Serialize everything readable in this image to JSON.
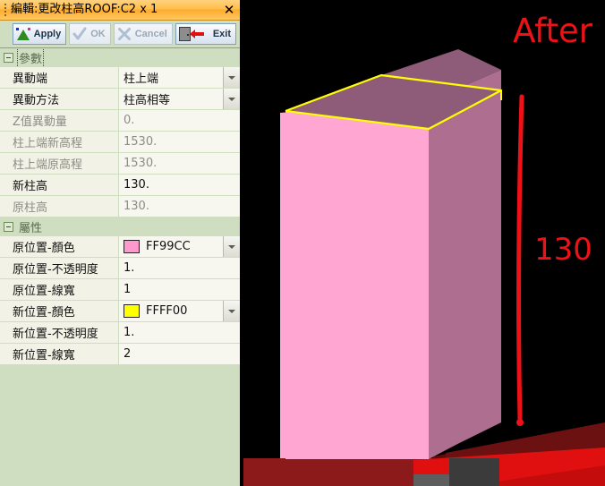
{
  "window": {
    "title": "編輯:更改柱高ROOF:C2 x 1",
    "close_label": "✕",
    "grip_icon": "drag-handle-icon"
  },
  "toolbar": {
    "buttons": [
      {
        "label": "Apply",
        "icon": "apply-triangle-icon",
        "enabled": true
      },
      {
        "label": "OK",
        "icon": "check-icon",
        "enabled": false
      },
      {
        "label": "Cancel",
        "icon": "close-x-icon",
        "enabled": false
      },
      {
        "label": "Exit",
        "icon": "exit-door-icon",
        "enabled": true
      }
    ]
  },
  "groups": [
    {
      "label": "參數",
      "focused": true,
      "rows": [
        {
          "name": "異動端",
          "value": "柱上端",
          "dim": false,
          "dropdown": true,
          "swatch": null
        },
        {
          "name": "異動方法",
          "value": "柱高相等",
          "dim": false,
          "dropdown": true,
          "swatch": null
        },
        {
          "name": "Z值異動量",
          "value": "0.",
          "dim": true,
          "dropdown": false,
          "swatch": null
        },
        {
          "name": "柱上端新高程",
          "value": "1530.",
          "dim": true,
          "dropdown": false,
          "swatch": null
        },
        {
          "name": "柱上端原高程",
          "value": "1530.",
          "dim": true,
          "dropdown": false,
          "swatch": null
        },
        {
          "name": "新柱高",
          "value": "130.",
          "dim": false,
          "dropdown": false,
          "swatch": null
        },
        {
          "name": "原柱高",
          "value": "130.",
          "dim": true,
          "dropdown": false,
          "swatch": null
        }
      ]
    },
    {
      "label": "屬性",
      "focused": false,
      "rows": [
        {
          "name": "原位置-顏色",
          "value": "FF99CC",
          "dim": false,
          "dropdown": true,
          "swatch": "#FF99CC"
        },
        {
          "name": "原位置-不透明度",
          "value": "1.",
          "dim": false,
          "dropdown": false,
          "swatch": null
        },
        {
          "name": "原位置-線寬",
          "value": "1",
          "dim": false,
          "dropdown": false,
          "swatch": null
        },
        {
          "name": "新位置-顏色",
          "value": "FFFF00",
          "dim": false,
          "dropdown": true,
          "swatch": "#FFFF00"
        },
        {
          "name": "新位置-不透明度",
          "value": "1.",
          "dim": false,
          "dropdown": false,
          "swatch": null
        },
        {
          "name": "新位置-線寬",
          "value": "2",
          "dim": false,
          "dropdown": false,
          "swatch": null
        }
      ]
    }
  ],
  "viewport": {
    "after_label": "After",
    "dimension_label": "130",
    "annotation_color": "#EE1118",
    "column_front_color": "#FFA6D2",
    "column_side_color": "#AD6E90",
    "column_top_color": "#8E5B78",
    "new_edge_color": "#FFFF00",
    "ground_colors": [
      "#7D1414",
      "#8C1A1A",
      "#5E0C0C",
      "#E01010",
      "#C40C0C",
      "#6B1111"
    ],
    "background_color": "#000000"
  }
}
